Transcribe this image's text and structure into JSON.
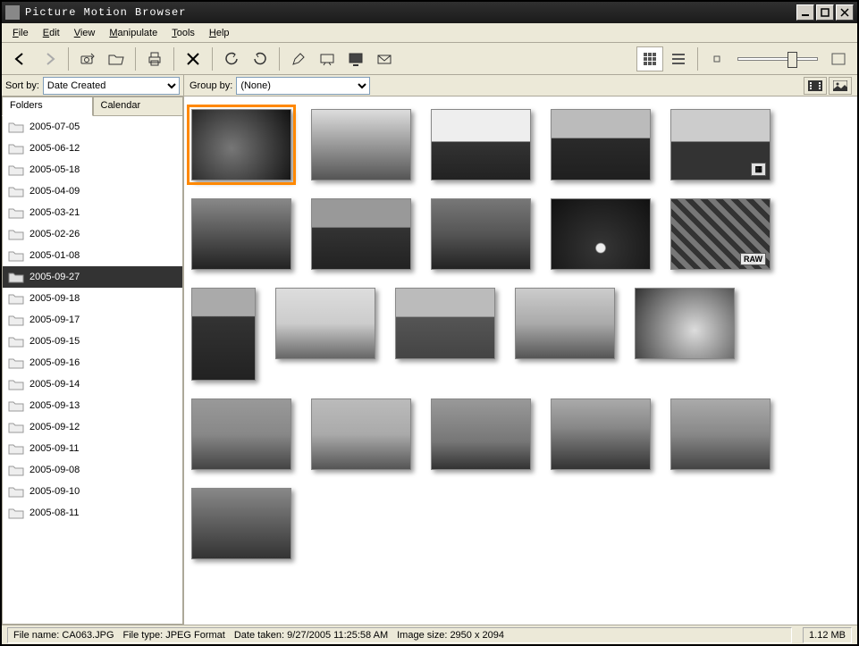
{
  "app": {
    "title": "Picture Motion Browser"
  },
  "menu": {
    "file": "File",
    "edit": "Edit",
    "view": "View",
    "manipulate": "Manipulate",
    "tools": "Tools",
    "help": "Help"
  },
  "sidebar": {
    "sort_label": "Sort by:",
    "sort_value": "Date Created",
    "tab_folders": "Folders",
    "tab_calendar": "Calendar",
    "folders": [
      {
        "label": "2005-07-05"
      },
      {
        "label": "2005-06-12"
      },
      {
        "label": "2005-05-18"
      },
      {
        "label": "2005-04-09"
      },
      {
        "label": "2005-03-21"
      },
      {
        "label": "2005-02-26"
      },
      {
        "label": "2005-01-08"
      },
      {
        "label": "2005-09-27"
      },
      {
        "label": "2005-09-18"
      },
      {
        "label": "2005-09-17"
      },
      {
        "label": "2005-09-15"
      },
      {
        "label": "2005-09-16"
      },
      {
        "label": "2005-09-14"
      },
      {
        "label": "2005-09-13"
      },
      {
        "label": "2005-09-12"
      },
      {
        "label": "2005-09-11"
      },
      {
        "label": "2005-09-08"
      },
      {
        "label": "2005-09-10"
      },
      {
        "label": "2005-08-11"
      }
    ],
    "selected_index": 7
  },
  "content": {
    "group_label": "Group by:",
    "group_value": "(None)",
    "thumbs": [
      {
        "bg": "radial-gradient(circle at 40% 55%,#777,#111)",
        "selected": true
      },
      {
        "bg": "linear-gradient(#ddd,#555)"
      },
      {
        "bg": "linear-gradient(#eee 0%,#eee 45%,#333 46%,#222 100%)"
      },
      {
        "bg": "linear-gradient(#bbb 0%,#bbb 40%,#2a2a2a 41%,#1f1f1f 100%)"
      },
      {
        "bg": "linear-gradient(#ccc 0%,#ccc 45%,#333 46%,#333 100%)",
        "badge": "▦"
      },
      {
        "bg": "linear-gradient(#888,#222)"
      },
      {
        "bg": "linear-gradient(#999 0%,#999 40%,#333 41%,#222 100%)"
      },
      {
        "bg": "linear-gradient(#777 0%,#555 50%,#222 100%)"
      },
      {
        "bg": "radial-gradient(circle at 50% 70%,#eee 0%,#eee 6%,#333 8%,#111 100%)"
      },
      {
        "bg": "repeating-linear-gradient(45deg,#777,#777 6px,#333 6px,#333 12px)",
        "badge": "RAW"
      },
      {
        "bg": "linear-gradient(#aaa 0%,#aaa 30%,#333 31%,#222 100%)",
        "portrait": true
      },
      {
        "bg": "linear-gradient(#ddd 0%,#ccc 50%,#666 100%)"
      },
      {
        "bg": "linear-gradient(#bbb 0%,#bbb 40%,#555 41%,#444 100%)"
      },
      {
        "bg": "linear-gradient(#ccc 0%,#aaa 50%,#555 100%)"
      },
      {
        "bg": "radial-gradient(circle at 60% 60%,#ddd,#333)"
      },
      {
        "bg": "linear-gradient(#999 0%,#888 50%,#444 100%)"
      },
      {
        "bg": "linear-gradient(#bbb 0%,#aaa 50%,#555 100%)"
      },
      {
        "bg": "linear-gradient(#999 0%,#777 60%,#333 100%)"
      },
      {
        "bg": "linear-gradient(#aaa 0%,#888 40%,#333 100%)"
      },
      {
        "bg": "linear-gradient(#aaa 0%,#888 50%,#444 100%)"
      },
      {
        "bg": "linear-gradient(#888,#333)"
      }
    ]
  },
  "status": {
    "file_name_label": "File name:",
    "file_name": "CA063.JPG",
    "file_type_label": "File type:",
    "file_type": "JPEG Format",
    "date_taken_label": "Date taken:",
    "date_taken": "9/27/2005 11:25:58 AM",
    "image_size_label": "Image size:",
    "image_size": "2950 x 2094",
    "file_size": "1.12 MB"
  }
}
